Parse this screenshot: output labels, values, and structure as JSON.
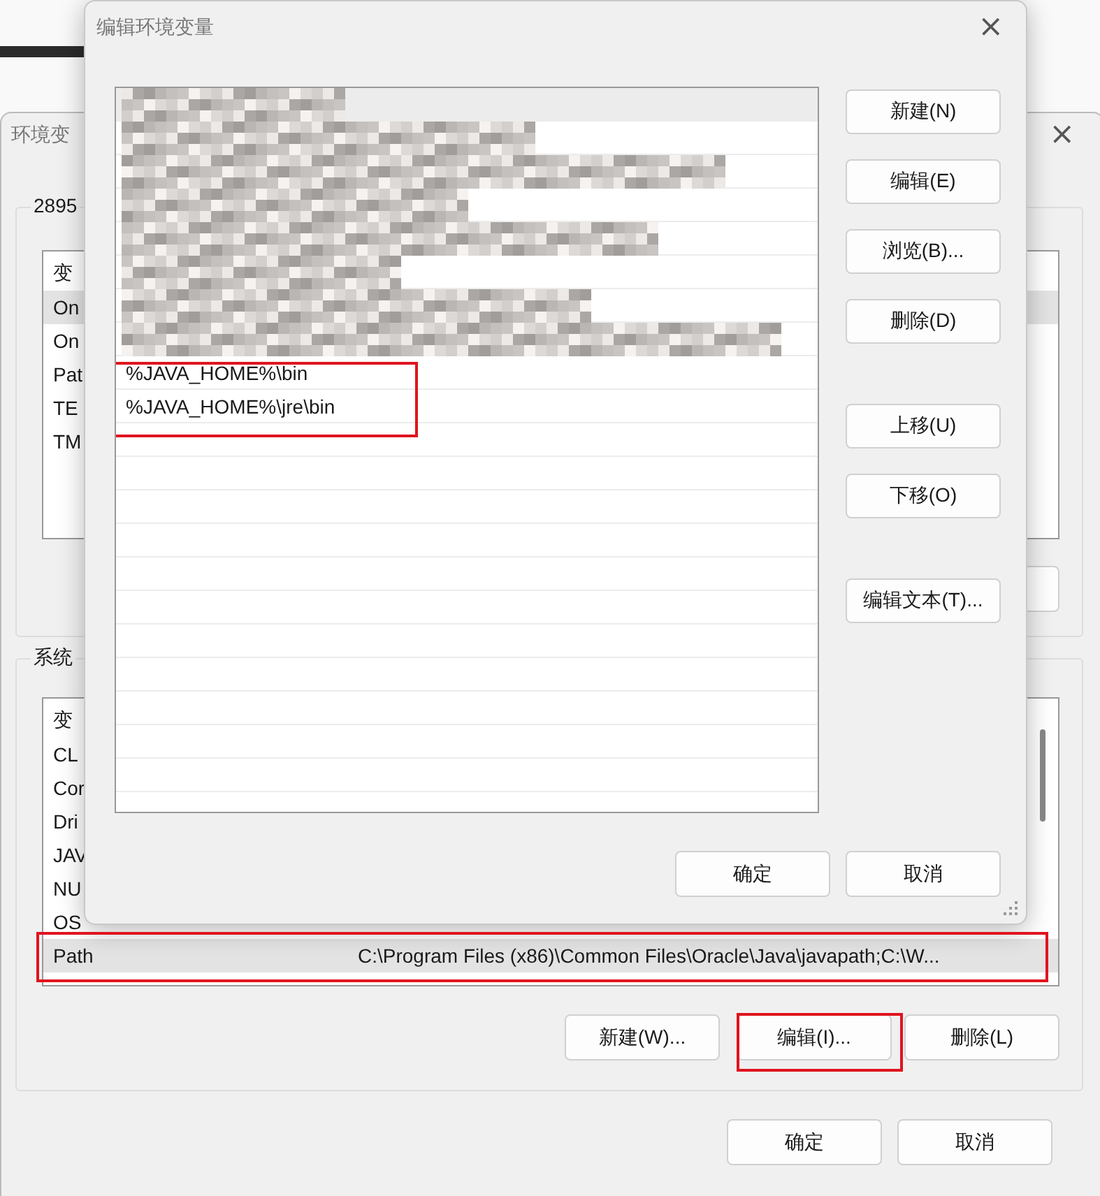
{
  "back_window": {
    "title": "环境变",
    "close": "×",
    "user_group": {
      "label": "2895",
      "header": "变",
      "rows": [
        {
          "name": "On",
          "selected": true
        },
        {
          "name": "On",
          "selected": false
        },
        {
          "name": "Pat",
          "selected": false
        },
        {
          "name": "TE",
          "selected": false
        },
        {
          "name": "TM",
          "selected": false
        }
      ]
    },
    "system_group": {
      "label": "系统",
      "header": "变",
      "rows": [
        {
          "name": "CL",
          "value": "",
          "selected": false
        },
        {
          "name": "Cor",
          "value": "",
          "selected": false
        },
        {
          "name": "Dri",
          "value": "",
          "selected": false
        },
        {
          "name": "JAV",
          "value": "",
          "selected": false
        },
        {
          "name": "NU",
          "value": "",
          "selected": false
        },
        {
          "name": "OS",
          "value": "",
          "selected": false
        },
        {
          "name": "Path",
          "value": "C:\\Program Files (x86)\\Common Files\\Oracle\\Java\\javapath;C:\\W...",
          "selected": true
        }
      ],
      "buttons": [
        "新建(W)...",
        "编辑(I)...",
        "删除(L)"
      ]
    },
    "buttons": [
      "确定",
      "取消"
    ]
  },
  "front_window": {
    "title": "编辑环境变量",
    "close": "×",
    "entries": [
      {
        "kind": "redacted",
        "selected": true
      },
      {
        "kind": "redacted",
        "selected": false
      },
      {
        "kind": "redacted",
        "selected": false
      },
      {
        "kind": "redacted",
        "selected": false
      },
      {
        "kind": "redacted",
        "selected": false
      },
      {
        "kind": "redacted",
        "selected": false
      },
      {
        "kind": "redacted",
        "selected": false
      },
      {
        "kind": "redacted",
        "selected": false
      },
      {
        "kind": "text",
        "text": "%JAVA_HOME%\\bin",
        "selected": false
      },
      {
        "kind": "text",
        "text": "%JAVA_HOME%\\jre\\bin",
        "selected": false
      }
    ],
    "side_button_groups": [
      [
        "新建(N)",
        "编辑(E)",
        "浏览(B)...",
        "删除(D)"
      ],
      [
        "上移(U)",
        "下移(O)"
      ],
      [
        "编辑文本(T)..."
      ]
    ],
    "buttons": [
      "确定",
      "取消"
    ]
  }
}
